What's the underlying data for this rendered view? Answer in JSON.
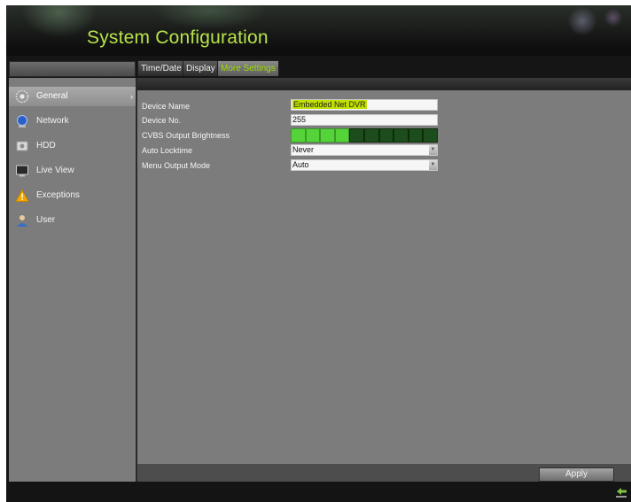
{
  "header": {
    "title": "System Configuration"
  },
  "tabs": [
    {
      "label": "Time/Date",
      "active": false
    },
    {
      "label": "Display",
      "active": false
    },
    {
      "label": "More Settings",
      "active": true
    }
  ],
  "sidebar": {
    "items": [
      {
        "label": "General",
        "icon": "gear-icon",
        "selected": true
      },
      {
        "label": "Network",
        "icon": "network-globe-icon",
        "selected": false
      },
      {
        "label": "HDD",
        "icon": "hdd-icon",
        "selected": false
      },
      {
        "label": "Live View",
        "icon": "monitor-icon",
        "selected": false
      },
      {
        "label": "Exceptions",
        "icon": "warning-icon",
        "selected": false
      },
      {
        "label": "User",
        "icon": "user-icon",
        "selected": false
      }
    ]
  },
  "form": {
    "device_name_label": "Device Name",
    "device_name_value": "Embedded Net DVR",
    "device_no_label": "Device No.",
    "device_no_value": "255",
    "brightness_label": "CVBS Output Brightness",
    "brightness_level": 4,
    "brightness_max": 10,
    "auto_lock_label": "Auto Locktime",
    "auto_lock_value": "Never",
    "menu_output_label": "Menu Output Mode",
    "menu_output_value": "Auto"
  },
  "footer": {
    "apply_label": "Apply"
  },
  "colors": {
    "accent_green": "#b6e24a",
    "tab_active_text": "#9fe000",
    "panel_gray": "#7c7c7c",
    "brightness_on": "#55d43a",
    "brightness_off": "#1d4d1d"
  }
}
